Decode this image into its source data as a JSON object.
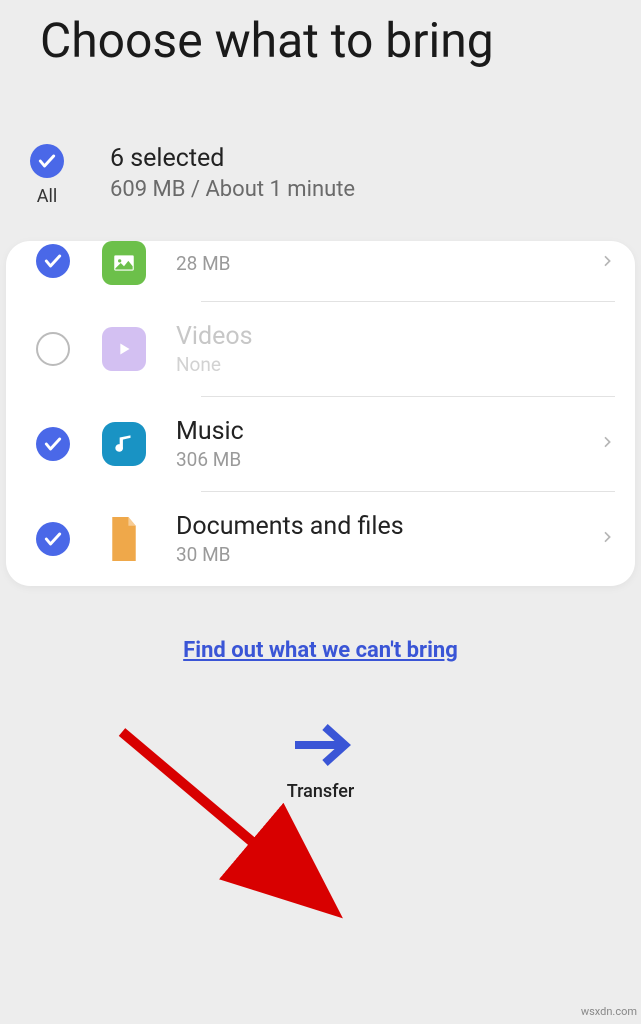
{
  "title": "Choose what to bring",
  "summary": {
    "all_label": "All",
    "count_label": "6 selected",
    "size_label": "609 MB / About 1 minute"
  },
  "items": [
    {
      "label": "",
      "sub": "28 MB",
      "checked": true,
      "icon": "image",
      "disabled": false,
      "chevron": true
    },
    {
      "label": "Videos",
      "sub": "None",
      "checked": false,
      "icon": "video",
      "disabled": true,
      "chevron": false
    },
    {
      "label": "Music",
      "sub": "306 MB",
      "checked": true,
      "icon": "music",
      "disabled": false,
      "chevron": true
    },
    {
      "label": "Documents and files",
      "sub": "30 MB",
      "checked": true,
      "icon": "document",
      "disabled": false,
      "chevron": true
    }
  ],
  "link_text": "Find out what we can't bring",
  "transfer_label": "Transfer",
  "watermark": "wsxdn.com",
  "colors": {
    "accent_blue": "#4a68e8",
    "link_blue": "#3a55d6"
  }
}
